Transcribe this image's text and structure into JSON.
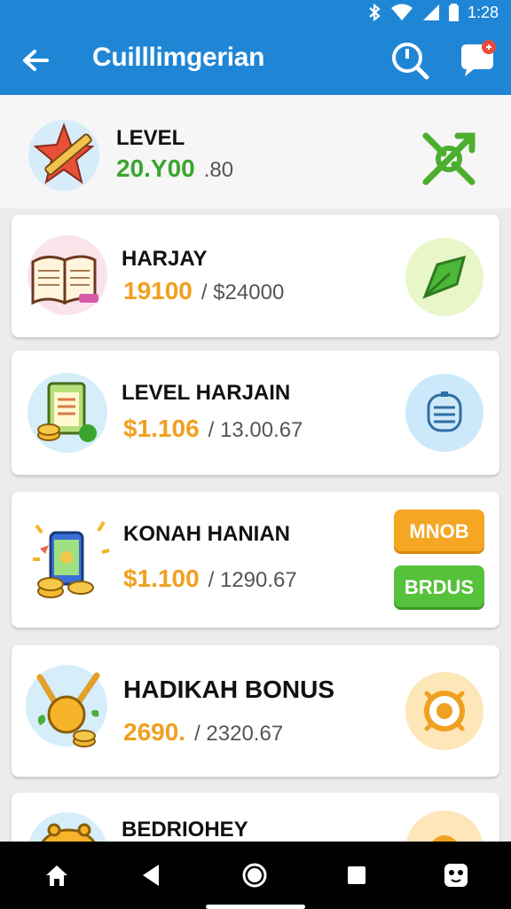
{
  "status": {
    "time": "1:28"
  },
  "header": {
    "title": "Cuilllimgerian"
  },
  "items": [
    {
      "name": "LEVEL",
      "price": "20.Y00",
      "secondary": ".80",
      "icon": "star-pencil-icon"
    },
    {
      "name": "HARJAY",
      "price": "19100",
      "secondary": "/ $24000",
      "icon": "book-icon"
    },
    {
      "name": "LEVEL HARJAIN",
      "price": "$1.106",
      "secondary": "/ 13.00.67",
      "icon": "bill-coins-icon"
    },
    {
      "name": "KONAH HANIAN",
      "price": "$1.100",
      "secondary": "/ 1290.67",
      "icon": "phone-coins-icon",
      "buttons": [
        "MNOB",
        "BRDUS"
      ]
    },
    {
      "name": "HADIKAH BONUS",
      "price": "2690.",
      "secondary": "/ 2320.67",
      "icon": "slingshot-coins-icon"
    },
    {
      "name": "BEDRIOHEY",
      "price": "",
      "secondary": "",
      "icon": "piggy-bank-icon"
    }
  ],
  "colors": {
    "appbar": "#1f86d6",
    "green": "#3aa52e",
    "orange": "#f0a020"
  }
}
